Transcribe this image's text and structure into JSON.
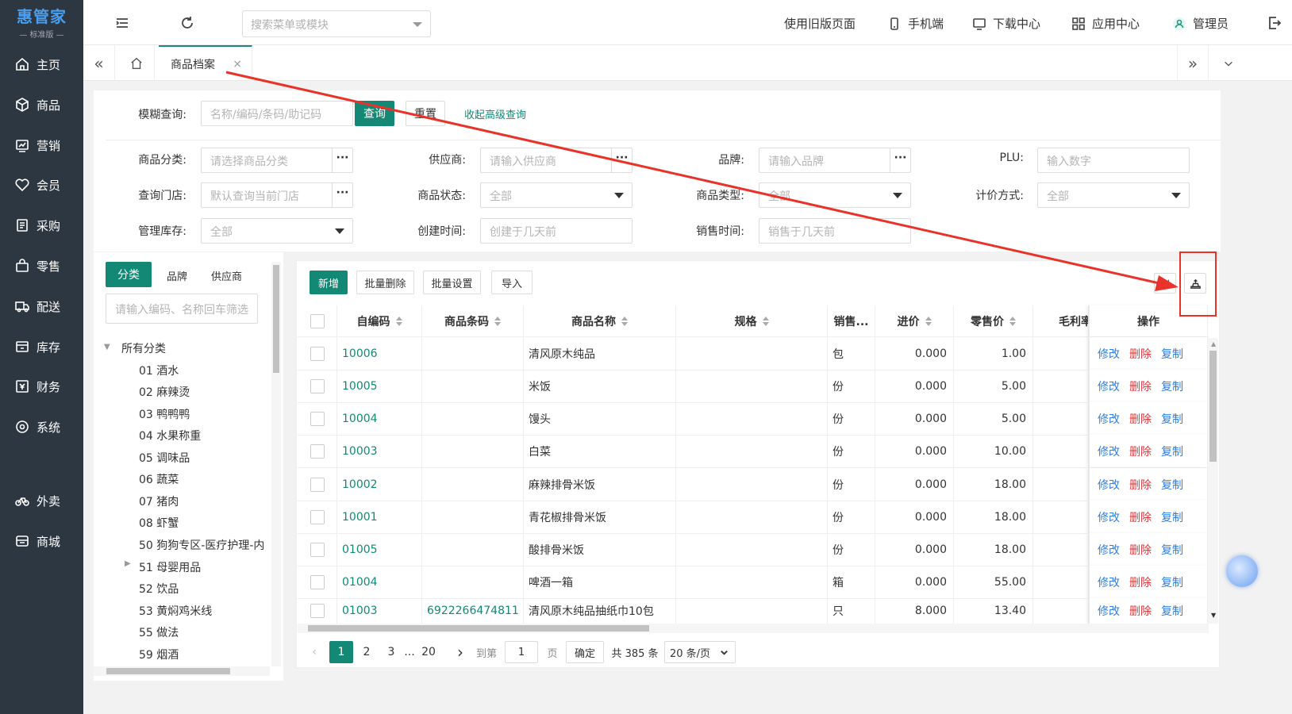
{
  "brand": {
    "name": "惠管家",
    "edition": "— 标准版 —"
  },
  "sidebar": {
    "items": [
      {
        "label": "主页",
        "icon": "home-icon"
      },
      {
        "label": "商品",
        "icon": "box-icon"
      },
      {
        "label": "营销",
        "icon": "chart-icon"
      },
      {
        "label": "会员",
        "icon": "heart-icon"
      },
      {
        "label": "采购",
        "icon": "purchase-icon"
      },
      {
        "label": "零售",
        "icon": "bag-icon"
      },
      {
        "label": "配送",
        "icon": "truck-icon"
      },
      {
        "label": "库存",
        "icon": "warehouse-icon"
      },
      {
        "label": "财务",
        "icon": "finance-icon"
      },
      {
        "label": "系统",
        "icon": "settings-icon"
      },
      {
        "label": "外卖",
        "icon": "bike-icon"
      },
      {
        "label": "商城",
        "icon": "store-icon"
      }
    ]
  },
  "topbar": {
    "search_placeholder": "搜索菜单或模块",
    "old_version": "使用旧版页面",
    "mobile": "手机端",
    "download": "下载中心",
    "apps": "应用中心",
    "user": "管理员"
  },
  "tabs": {
    "active": "商品档案"
  },
  "filters": {
    "fuzzy_label": "模糊查询:",
    "fuzzy_placeholder": "名称/编码/条码/助记码",
    "query_btn": "查询",
    "reset_btn": "重置",
    "collapse_link": "收起高级查询",
    "category_label": "商品分类:",
    "category_placeholder": "请选择商品分类",
    "supplier_label": "供应商:",
    "supplier_placeholder": "请输入供应商",
    "brand_label": "品牌:",
    "brand_placeholder": "请输入品牌",
    "plu_label": "PLU:",
    "plu_placeholder": "输入数字",
    "store_label": "查询门店:",
    "store_placeholder": "默认查询当前门店",
    "status_label": "商品状态:",
    "status_value": "全部",
    "type_label": "商品类型:",
    "type_value": "全部",
    "pricing_label": "计价方式:",
    "pricing_value": "全部",
    "stock_label": "管理库存:",
    "stock_value": "全部",
    "created_label": "创建时间:",
    "created_placeholder": "创建于几天前",
    "sold_label": "销售时间:",
    "sold_placeholder": "销售于几天前"
  },
  "left_panel": {
    "tabs": [
      "分类",
      "品牌",
      "供应商"
    ],
    "search_placeholder": "请输入编码、名称回车筛选",
    "root": "所有分类",
    "categories": [
      "01 酒水",
      "02 麻辣烫",
      "03 鸭鸭鸭",
      "04 水果称重",
      "05 调味品",
      "06 蔬菜",
      "07 猪肉",
      "08 虾蟹",
      "50 狗狗专区-医疗护理-内",
      "51 母婴用品",
      "52 饮品",
      "53 黄焖鸡米线",
      "55 做法",
      "59 烟酒"
    ]
  },
  "toolbar": {
    "add": "新增",
    "batch_delete": "批量删除",
    "batch_set": "批量设置",
    "import": "导入"
  },
  "table": {
    "headers": [
      "自编码",
      "商品条码",
      "商品名称",
      "规格",
      "销售...",
      "进价",
      "零售价",
      "毛利率",
      "操作"
    ],
    "ops": [
      "修改",
      "删除",
      "复制"
    ],
    "rows": [
      {
        "code": "10006",
        "barcode": "",
        "name": "清风原木纯品",
        "spec": "",
        "unit": "包",
        "cost": "0.000",
        "price": "1.00"
      },
      {
        "code": "10005",
        "barcode": "",
        "name": "米饭",
        "spec": "",
        "unit": "份",
        "cost": "0.000",
        "price": "5.00"
      },
      {
        "code": "10004",
        "barcode": "",
        "name": "馒头",
        "spec": "",
        "unit": "份",
        "cost": "0.000",
        "price": "5.00"
      },
      {
        "code": "10003",
        "barcode": "",
        "name": "白菜",
        "spec": "",
        "unit": "份",
        "cost": "0.000",
        "price": "10.00"
      },
      {
        "code": "10002",
        "barcode": "",
        "name": "麻辣排骨米饭",
        "spec": "",
        "unit": "份",
        "cost": "0.000",
        "price": "18.00"
      },
      {
        "code": "10001",
        "barcode": "",
        "name": "青花椒排骨米饭",
        "spec": "",
        "unit": "份",
        "cost": "0.000",
        "price": "18.00"
      },
      {
        "code": "01005",
        "barcode": "",
        "name": "酸排骨米饭",
        "spec": "",
        "unit": "份",
        "cost": "0.000",
        "price": "18.00"
      },
      {
        "code": "01004",
        "barcode": "",
        "name": "啤酒一箱",
        "spec": "",
        "unit": "箱",
        "cost": "0.000",
        "price": "55.00"
      },
      {
        "code": "01003",
        "barcode": "6922266474811",
        "name": "清风原木纯品抽纸巾10包",
        "spec": "",
        "unit": "只",
        "cost": "8.000",
        "price": "13.40"
      }
    ]
  },
  "pagination": {
    "pages": [
      "1",
      "2",
      "3",
      "...",
      "20"
    ],
    "goto_label": "到第",
    "goto_value": "1",
    "page_unit": "页",
    "confirm": "确定",
    "total": "共 385 条",
    "page_size": "20 条/页"
  },
  "colors": {
    "primary": "#128875",
    "sidebar": "#2d3741",
    "link": "#2f7fe0",
    "danger": "#e0363a",
    "annotation": "#e8322a"
  }
}
